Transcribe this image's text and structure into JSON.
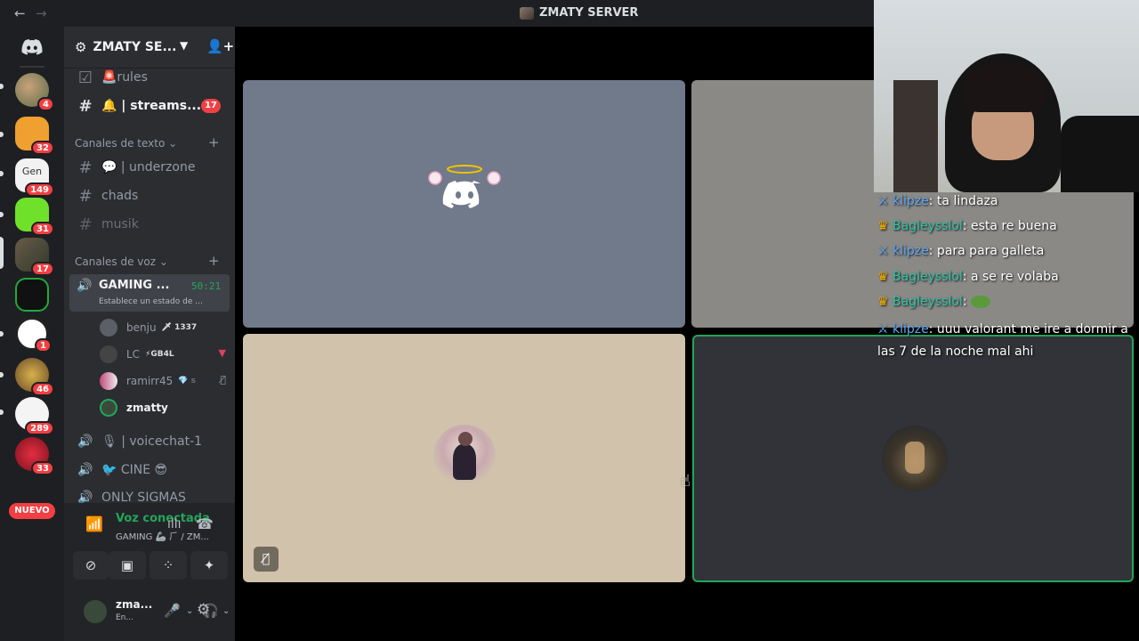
{
  "titlebar": {
    "back_icon": "arrow-left-icon",
    "forward_icon": "arrow-right-icon",
    "title": "ZMATY SERVER"
  },
  "servers": {
    "home_icon": "discord-icon",
    "items": [
      {
        "badge": "4"
      },
      {
        "badge": "32"
      },
      {
        "label": "Gen",
        "badge": "149"
      },
      {
        "badge": "31"
      },
      {
        "badge": "17"
      },
      {
        "badge": ""
      },
      {
        "badge": "1"
      },
      {
        "badge": "46"
      },
      {
        "badge": "289"
      },
      {
        "badge": "33"
      }
    ],
    "new_label": "NUEVO"
  },
  "sidebar": {
    "server_name": "ZMATY SE...",
    "channels_top": [
      {
        "name": "🚨rules"
      },
      {
        "name": "🔔 | streams...",
        "count": "17"
      }
    ],
    "text_category": "Canales de texto",
    "text_channels": [
      {
        "name": "💬 | underzone"
      },
      {
        "name": "chads"
      },
      {
        "name": "musik"
      }
    ],
    "voice_category": "Canales de voz",
    "active_voice": {
      "name": "GAMING ...",
      "time": "50:21",
      "status": "Establece un estado de ..."
    },
    "voice_users": [
      {
        "name": "benju",
        "tag": "🗡 1337"
      },
      {
        "name": "LC",
        "tag": "⚡GB4L"
      },
      {
        "name": "ramirr45",
        "tag": "💎 s"
      },
      {
        "name": "zmatty",
        "tag": ""
      }
    ],
    "voice_channels": [
      {
        "name": "🎙 | voicechat-1"
      },
      {
        "name": "🐦 CINE 😎"
      },
      {
        "name": "ONLY SIGMAS"
      }
    ]
  },
  "voice_panel": {
    "connected": "Voz conectada",
    "sub": "GAMING 🦾 ⺁ / ZM..."
  },
  "user": {
    "name": "zma...",
    "status": "En..."
  },
  "chat": [
    {
      "user": "klipze",
      "text": ": ta lindaza",
      "color": "#5fa8f5"
    },
    {
      "user": "Bagleysslol",
      "text": ": esta re buena",
      "color": "#2ec4a6"
    },
    {
      "user": "klipze",
      "text": ": para para galleta",
      "color": "#5fa8f5"
    },
    {
      "user": "Bagleysslol",
      "text": ": a se re volaba",
      "color": "#2ec4a6"
    },
    {
      "user": "Bagleysslol",
      "text": ":",
      "color": "#2ec4a6"
    },
    {
      "user": "klipze",
      "text": ": uuu valorant me ire a dormir a",
      "color": "#5fa8f5"
    }
  ],
  "chat_continuation": "las 7 de la noche mal ahi",
  "colors": {
    "accent_green": "#23a55a",
    "badge_red": "#f23f43",
    "tile_blue": "#707a8a",
    "tile_gray": "#8a8986",
    "tile_beige": "#d1c2ab",
    "tile_dark": "#313338"
  }
}
